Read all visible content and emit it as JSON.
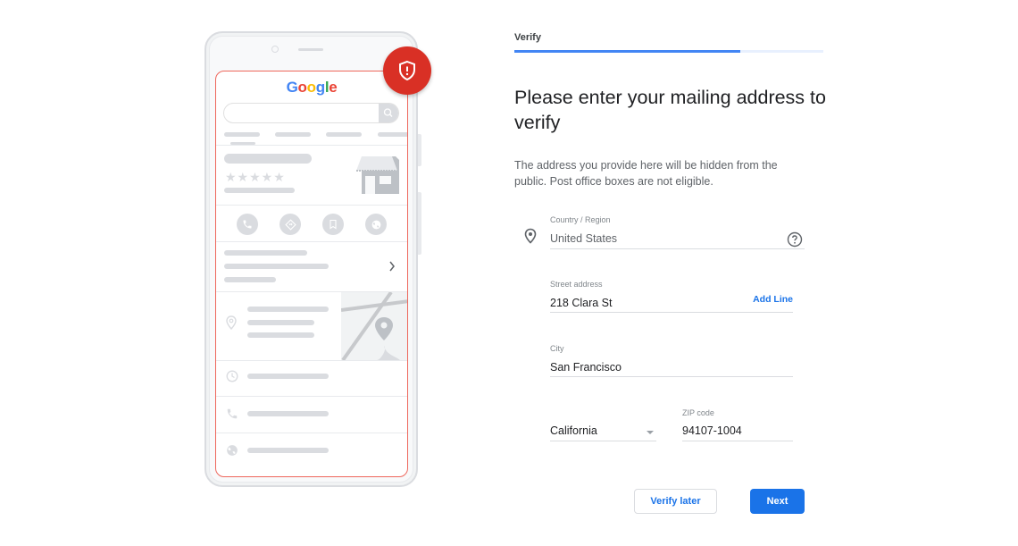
{
  "illustration": {
    "logo_letters": [
      {
        "ch": "G",
        "color": "#4285f4"
      },
      {
        "ch": "o",
        "color": "#ea4335"
      },
      {
        "ch": "o",
        "color": "#fbbc05"
      },
      {
        "ch": "g",
        "color": "#4285f4"
      },
      {
        "ch": "l",
        "color": "#34a853"
      },
      {
        "ch": "e",
        "color": "#ea4335"
      }
    ],
    "stars": "★★★★★",
    "badge_icon": "shield-alert-icon",
    "badge_color": "#d93025",
    "highlight_color": "#ee675c"
  },
  "stepper": {
    "label": "Verify",
    "progress_percent": 73,
    "accent_color": "#4285f4"
  },
  "header": {
    "title": "Please enter your mailing address to verify",
    "description": "The address you provide here will be hidden from the public. Post office boxes are not eligible."
  },
  "form": {
    "country": {
      "label": "Country / Region",
      "value": "United States",
      "icon": "location-pin-icon",
      "help_icon": "help-circle-icon"
    },
    "street": {
      "label": "Street address",
      "value": "218 Clara St",
      "add_line_label": "Add Line"
    },
    "city": {
      "label": "City",
      "value": "San Francisco"
    },
    "state": {
      "value": "California"
    },
    "zip": {
      "label": "ZIP code",
      "value": "94107-1004"
    }
  },
  "actions": {
    "secondary_label": "Verify later",
    "primary_label": "Next",
    "primary_color": "#1a73e8"
  }
}
